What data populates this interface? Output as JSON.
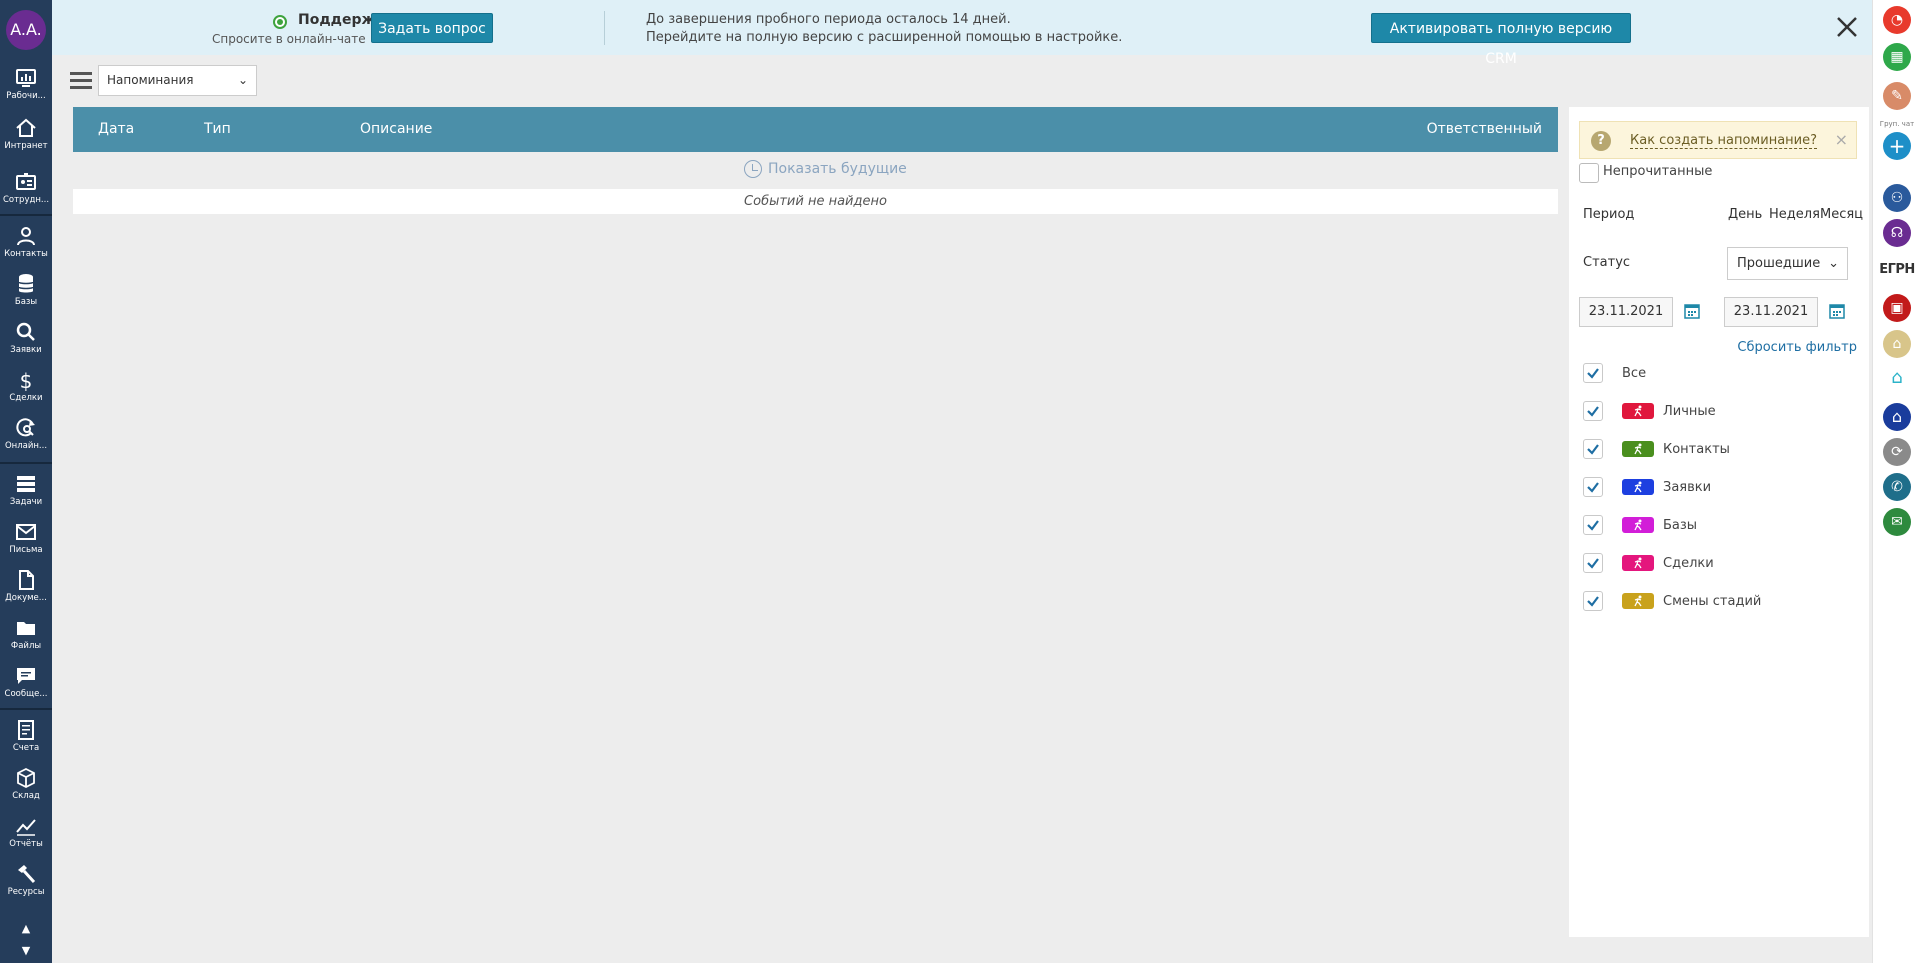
{
  "user": {
    "initials": "A.A."
  },
  "sidebar": {
    "items": [
      {
        "id": "desktops",
        "label": "Рабочи...",
        "icon": "dashboard-icon"
      },
      {
        "id": "intranet",
        "label": "Интранет",
        "icon": "home-icon"
      },
      {
        "id": "employees",
        "label": "Сотрудн...",
        "icon": "id-card-icon"
      },
      {
        "id": "contacts",
        "label": "Контакты",
        "icon": "person-icon"
      },
      {
        "id": "bases",
        "label": "Базы",
        "icon": "database-icon"
      },
      {
        "id": "requests",
        "label": "Заявки",
        "icon": "search-icon"
      },
      {
        "id": "deals",
        "label": "Сделки",
        "icon": "dollar-icon"
      },
      {
        "id": "online",
        "label": "Онлайн...",
        "icon": "refresh-search-icon"
      },
      {
        "id": "tasks",
        "label": "Задачи",
        "icon": "tasks-icon"
      },
      {
        "id": "letters",
        "label": "Письма",
        "icon": "envelope-icon"
      },
      {
        "id": "documents",
        "label": "Докуме...",
        "icon": "document-icon"
      },
      {
        "id": "files",
        "label": "Файлы",
        "icon": "folder-icon"
      },
      {
        "id": "messages",
        "label": "Сообще...",
        "icon": "chat-icon"
      },
      {
        "id": "invoices",
        "label": "Счета",
        "icon": "invoice-icon"
      },
      {
        "id": "warehouse",
        "label": "Склад",
        "icon": "cube-icon"
      },
      {
        "id": "reports",
        "label": "Отчёты",
        "icon": "chart-line-icon"
      },
      {
        "id": "resources",
        "label": "Ресурсы",
        "icon": "hammer-icon"
      }
    ]
  },
  "banner": {
    "support_title": "Поддержка",
    "support_sub": "Спросите в онлайн-чате",
    "ask_button": "Задать вопрос",
    "trial_line1": "До завершения пробного периода осталось 14 дней.",
    "trial_line2": "Перейдите на полную версию с расширенной помощью в настройке.",
    "activate_button": "Активировать полную версию CRM"
  },
  "toolbar": {
    "view_select": "Напоминания"
  },
  "table": {
    "columns": [
      "Дата",
      "Тип",
      "Описание",
      "Ответственный"
    ],
    "show_future": "Показать будущие",
    "empty_text": "Событий не найдено"
  },
  "filter": {
    "hint_link": "Как создать напоминание?",
    "unread_label": "Непрочитанные",
    "period_label": "Период",
    "period_options": [
      "День",
      "Неделя",
      "Месяц"
    ],
    "status_label": "Статус",
    "status_value": "Прошедшие",
    "date_from": "23.11.2021",
    "date_to": "23.11.2021",
    "reset_link": "Сбросить фильтр",
    "types": [
      {
        "label": "Все",
        "checked": true,
        "color": ""
      },
      {
        "label": "Личные",
        "checked": true,
        "color": "#e0173d"
      },
      {
        "label": "Контакты",
        "checked": true,
        "color": "#4a8f1e"
      },
      {
        "label": "Заявки",
        "checked": true,
        "color": "#1d3fe0"
      },
      {
        "label": "Базы",
        "checked": true,
        "color": "#d21ed8"
      },
      {
        "label": "Сделки",
        "checked": true,
        "color": "#e4167d"
      },
      {
        "label": "Смены стадий",
        "checked": true,
        "color": "#c9a21c"
      }
    ]
  },
  "right_strip": {
    "group_chat_label": "Груп. чат",
    "egrn_label": "ЕГРН"
  },
  "colors": {
    "sidebar_bg": "#253d5b",
    "accent": "#1e88a8",
    "table_header": "#4b8fa9",
    "banner_bg": "#dff0f7"
  }
}
